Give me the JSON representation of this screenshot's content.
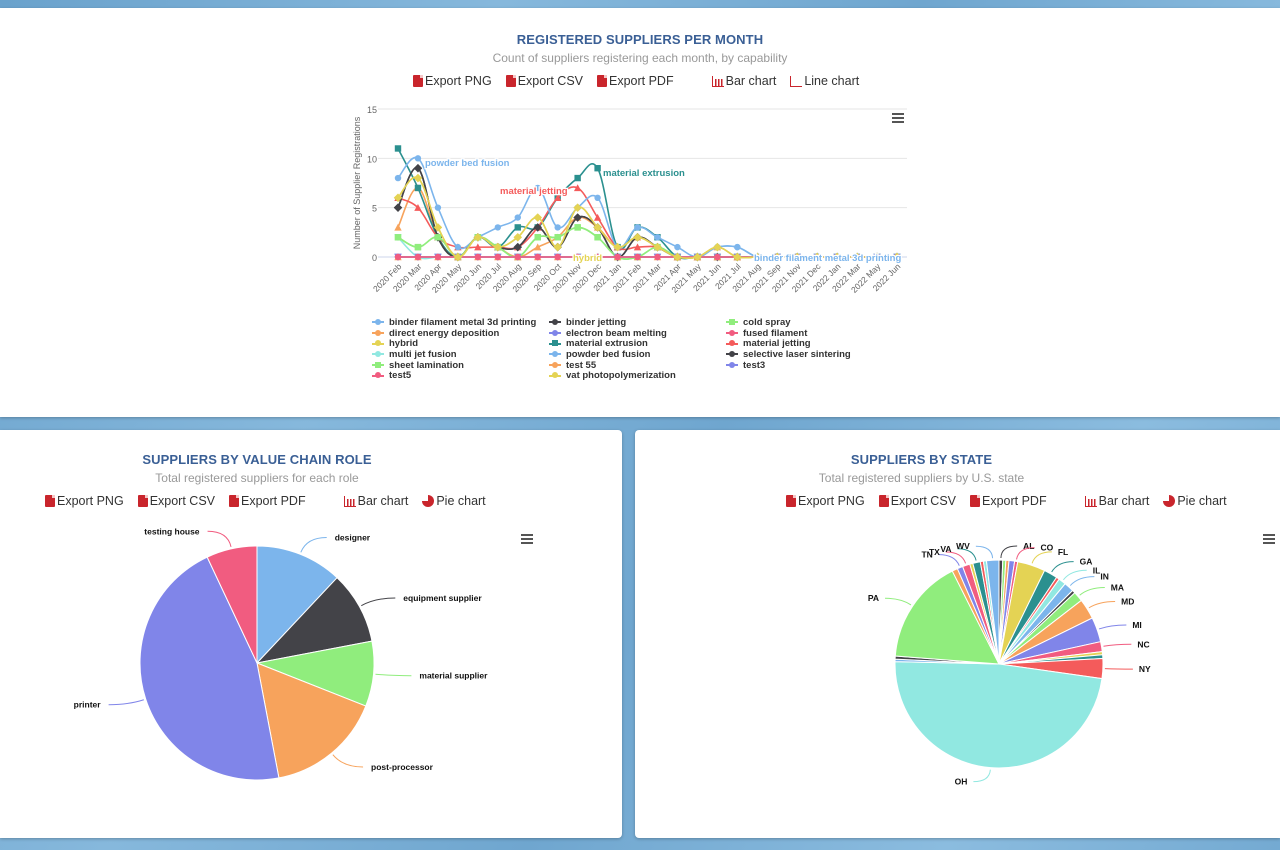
{
  "toolbar_labels": {
    "export_png": "Export PNG",
    "export_csv": "Export CSV",
    "export_pdf": "Export PDF",
    "bar_chart": "Bar chart",
    "line_chart": "Line chart",
    "pie_chart": "Pie chart"
  },
  "panels": {
    "monthly": {
      "title": "REGISTERED SUPPLIERS PER MONTH",
      "subtitle": "Count of suppliers registering each month, by capability"
    },
    "role": {
      "title": "SUPPLIERS BY VALUE CHAIN ROLE",
      "subtitle": "Total registered suppliers for each role"
    },
    "state": {
      "title": "SUPPLIERS BY STATE",
      "subtitle": "Total registered suppliers by U.S. state"
    }
  },
  "chart_data": [
    {
      "type": "line",
      "title": "REGISTERED SUPPLIERS PER MONTH",
      "xlabel": "",
      "ylabel": "Number of Supplier Registrations",
      "ylim": [
        0,
        15
      ],
      "yticks": [
        0,
        5,
        10,
        15
      ],
      "grid": true,
      "legend": "bottom",
      "categories": [
        "2020 Feb",
        "2020 Mar",
        "2020 Apr",
        "2020 May",
        "2020 Jun",
        "2020 Jul",
        "2020 Aug",
        "2020 Sep",
        "2020 Oct",
        "2020 Nov",
        "2020 Dec",
        "2021 Jan",
        "2021 Feb",
        "2021 Mar",
        "2021 Apr",
        "2021 May",
        "2021 Jun",
        "2021 Jul",
        "2021 Aug",
        "2021 Sep",
        "2021 Nov",
        "2021 Dec",
        "2022 Jan",
        "2022 Mar",
        "2022 May",
        "2022 Jun"
      ],
      "series": [
        {
          "name": "binder filament metal 3d printing",
          "color": "#7cb5ec",
          "marker": "circle",
          "values": [
            0,
            0,
            0,
            0,
            0,
            0,
            0,
            0,
            0,
            0,
            0,
            0,
            0,
            0,
            0,
            0,
            1,
            1,
            0,
            0,
            0,
            0,
            0,
            0,
            0,
            0
          ]
        },
        {
          "name": "binder jetting",
          "color": "#434348",
          "marker": "diamond",
          "values": [
            5,
            9,
            2,
            0,
            2,
            1,
            1,
            3,
            1,
            4,
            3,
            0,
            2,
            1,
            0,
            0,
            0,
            0,
            0,
            0,
            0,
            0,
            0,
            0,
            0,
            0
          ]
        },
        {
          "name": "cold spray",
          "color": "#90ed7d",
          "marker": "square",
          "values": [
            2,
            1,
            2,
            0,
            2,
            1,
            0,
            2,
            2,
            3,
            2,
            0,
            0,
            1,
            0,
            0,
            0,
            0,
            0,
            0,
            0,
            0,
            0,
            0,
            0,
            0
          ]
        },
        {
          "name": "direct energy deposition",
          "color": "#f7a35c",
          "marker": "triangle",
          "values": [
            3,
            7,
            2,
            0,
            2,
            1,
            0,
            1,
            2,
            4,
            3,
            1,
            2,
            1,
            0,
            0,
            1,
            0,
            0,
            0,
            0,
            0,
            0,
            0,
            0,
            0
          ]
        },
        {
          "name": "electron beam melting",
          "color": "#8085e9",
          "marker": "triangle-down",
          "values": [
            0,
            0,
            0,
            0,
            0,
            0,
            0,
            0,
            0,
            0,
            0,
            0,
            0,
            0,
            0,
            0,
            0,
            0,
            0,
            0,
            0,
            0,
            0,
            0,
            0,
            0
          ]
        },
        {
          "name": "fused filament",
          "color": "#f15c80",
          "marker": "circle",
          "values": [
            0,
            0,
            0,
            0,
            0,
            0,
            0,
            0,
            0,
            0,
            0,
            0,
            0,
            0,
            0,
            0,
            0,
            0,
            0,
            0,
            0,
            0,
            0,
            0,
            0,
            0
          ]
        },
        {
          "name": "hybrid",
          "color": "#e4d354",
          "marker": "diamond",
          "values": [
            6,
            8,
            3,
            0,
            2,
            1,
            2,
            4,
            1,
            5,
            3,
            1,
            2,
            1,
            0,
            0,
            1,
            0,
            0,
            0,
            0,
            0,
            0,
            0,
            0,
            0
          ]
        },
        {
          "name": "material extrusion",
          "color": "#2b908f",
          "marker": "square",
          "values": [
            11,
            7,
            2,
            0,
            2,
            1,
            3,
            3,
            6,
            8,
            9,
            1,
            3,
            2,
            0,
            0,
            0,
            0,
            0,
            0,
            0,
            0,
            0,
            0,
            0,
            0
          ]
        },
        {
          "name": "material jetting",
          "color": "#f45b5b",
          "marker": "triangle",
          "values": [
            6,
            5,
            2,
            1,
            1,
            1,
            1,
            3,
            6,
            7,
            4,
            1,
            1,
            1,
            0,
            0,
            0,
            0,
            0,
            0,
            0,
            0,
            0,
            0,
            0,
            0
          ]
        },
        {
          "name": "multi jet fusion",
          "color": "#91e8e1",
          "marker": "triangle-down",
          "values": [
            2,
            0,
            0,
            0,
            0,
            0,
            0,
            0,
            0,
            0,
            0,
            0,
            0,
            0,
            0,
            0,
            0,
            0,
            0,
            0,
            0,
            0,
            0,
            0,
            0,
            0
          ]
        },
        {
          "name": "powder bed fusion",
          "color": "#7cb5ec",
          "marker": "circle",
          "values": [
            8,
            10,
            5,
            1,
            2,
            3,
            4,
            7,
            3,
            5,
            6,
            1,
            3,
            2,
            1,
            0,
            1,
            1,
            0,
            0,
            0,
            0,
            0,
            0,
            0,
            0
          ]
        },
        {
          "name": "selective laser sintering",
          "color": "#434348",
          "marker": "diamond",
          "values": [
            5,
            9,
            2,
            0,
            2,
            1,
            1,
            3,
            1,
            4,
            3,
            0,
            2,
            1,
            0,
            0,
            0,
            0,
            0,
            0,
            0,
            0,
            0,
            0,
            0,
            0
          ]
        },
        {
          "name": "sheet lamination",
          "color": "#90ed7d",
          "marker": "square",
          "values": [
            2,
            1,
            2,
            0,
            2,
            1,
            0,
            2,
            2,
            3,
            2,
            0,
            0,
            1,
            0,
            0,
            0,
            0,
            0,
            0,
            0,
            0,
            0,
            0,
            0,
            0
          ]
        },
        {
          "name": "test 55",
          "color": "#f7a35c",
          "marker": "triangle",
          "values": [
            0,
            0,
            0,
            0,
            0,
            0,
            0,
            0,
            0,
            0,
            0,
            0,
            0,
            0,
            0,
            0,
            0,
            0,
            0,
            0,
            0,
            0,
            0,
            0,
            0,
            0
          ]
        },
        {
          "name": "test3",
          "color": "#8085e9",
          "marker": "triangle-down",
          "values": [
            0,
            0,
            0,
            0,
            0,
            0,
            0,
            0,
            0,
            0,
            0,
            0,
            0,
            0,
            0,
            0,
            0,
            0,
            0,
            0,
            0,
            0,
            0,
            0,
            0,
            0
          ]
        },
        {
          "name": "test5",
          "color": "#f15c80",
          "marker": "circle",
          "values": [
            0,
            0,
            0,
            0,
            0,
            0,
            0,
            0,
            0,
            0,
            0,
            0,
            0,
            0,
            0,
            0,
            0,
            0,
            0,
            0,
            0,
            0,
            0,
            0,
            0,
            0
          ]
        },
        {
          "name": "vat photopolymerization",
          "color": "#e4d354",
          "marker": "diamond",
          "values": [
            6,
            8,
            3,
            0,
            2,
            1,
            2,
            4,
            1,
            5,
            3,
            1,
            2,
            1,
            0,
            0,
            1,
            0,
            0,
            0,
            0,
            0,
            0,
            0,
            0,
            0
          ]
        }
      ],
      "annotations": [
        {
          "text": "powder bed fusion",
          "series": "powder bed fusion",
          "color": "#7cb5ec"
        },
        {
          "text": "material extrusion",
          "series": "material extrusion",
          "color": "#2b908f"
        },
        {
          "text": "material jetting",
          "series": "material jetting",
          "color": "#f45b5b"
        },
        {
          "text": "hybrid",
          "series": "hybrid",
          "color": "#e4d354"
        },
        {
          "text": "binder filament metal 3d printing",
          "series": "binder filament metal 3d printing",
          "color": "#7cb5ec"
        }
      ]
    },
    {
      "type": "pie",
      "title": "SUPPLIERS BY VALUE CHAIN ROLE",
      "slices": [
        {
          "label": "designer",
          "value": 12,
          "color": "#7cb5ec"
        },
        {
          "label": "equipment supplier",
          "value": 10,
          "color": "#434348"
        },
        {
          "label": "material supplier",
          "value": 9,
          "color": "#90ed7d"
        },
        {
          "label": "post-processor",
          "value": 16,
          "color": "#f7a35c"
        },
        {
          "label": "printer",
          "value": 46,
          "color": "#8085e9"
        },
        {
          "label": "testing house",
          "value": 7,
          "color": "#f15c80"
        }
      ]
    },
    {
      "type": "pie",
      "title": "SUPPLIERS BY STATE",
      "slices": [
        {
          "label": "AL",
          "value": 0.6,
          "color": "#434348",
          "show": true
        },
        {
          "label": "",
          "value": 0.5,
          "color": "#90ed7d"
        },
        {
          "label": "",
          "value": 0.5,
          "color": "#f7a35c"
        },
        {
          "label": "",
          "value": 0.9,
          "color": "#8085e9"
        },
        {
          "label": "CO",
          "value": 0.5,
          "color": "#f15c80",
          "show": true
        },
        {
          "label": "FL",
          "value": 4.5,
          "color": "#e4d354",
          "show": true
        },
        {
          "label": "GA",
          "value": 2.2,
          "color": "#2b908f",
          "show": true
        },
        {
          "label": "",
          "value": 0.5,
          "color": "#f45b5b"
        },
        {
          "label": "IL",
          "value": 1.2,
          "color": "#91e8e1",
          "show": true
        },
        {
          "label": "IN",
          "value": 1.6,
          "color": "#7cb5ec",
          "show": true
        },
        {
          "label": "",
          "value": 0.5,
          "color": "#434348"
        },
        {
          "label": "MA",
          "value": 1.6,
          "color": "#90ed7d",
          "show": true
        },
        {
          "label": "MD",
          "value": 3.3,
          "color": "#f7a35c",
          "show": true
        },
        {
          "label": "MI",
          "value": 4.0,
          "color": "#8085e9",
          "show": true
        },
        {
          "label": "NC",
          "value": 1.6,
          "color": "#f15c80",
          "show": true
        },
        {
          "label": "",
          "value": 0.5,
          "color": "#e4d354"
        },
        {
          "label": "",
          "value": 0.6,
          "color": "#2b908f"
        },
        {
          "label": "NY",
          "value": 3.2,
          "color": "#f45b5b",
          "show": true
        },
        {
          "label": "OH",
          "value": 50,
          "color": "#91e8e1",
          "show": true
        },
        {
          "label": "",
          "value": 0.4,
          "color": "#7cb5ec"
        },
        {
          "label": "",
          "value": 0.5,
          "color": "#434348"
        },
        {
          "label": "PA",
          "value": 17,
          "color": "#90ed7d",
          "show": true
        },
        {
          "label": "",
          "value": 0.9,
          "color": "#f7a35c"
        },
        {
          "label": "TN",
          "value": 0.9,
          "color": "#8085e9",
          "show": true
        },
        {
          "label": "TX",
          "value": 1.2,
          "color": "#f15c80",
          "show": true
        },
        {
          "label": "",
          "value": 0.5,
          "color": "#e4d354"
        },
        {
          "label": "VA",
          "value": 1.2,
          "color": "#2b908f",
          "show": true
        },
        {
          "label": "",
          "value": 0.5,
          "color": "#f45b5b"
        },
        {
          "label": "",
          "value": 0.5,
          "color": "#91e8e1"
        },
        {
          "label": "WV",
          "value": 2.0,
          "color": "#7cb5ec",
          "show": true
        }
      ]
    }
  ]
}
